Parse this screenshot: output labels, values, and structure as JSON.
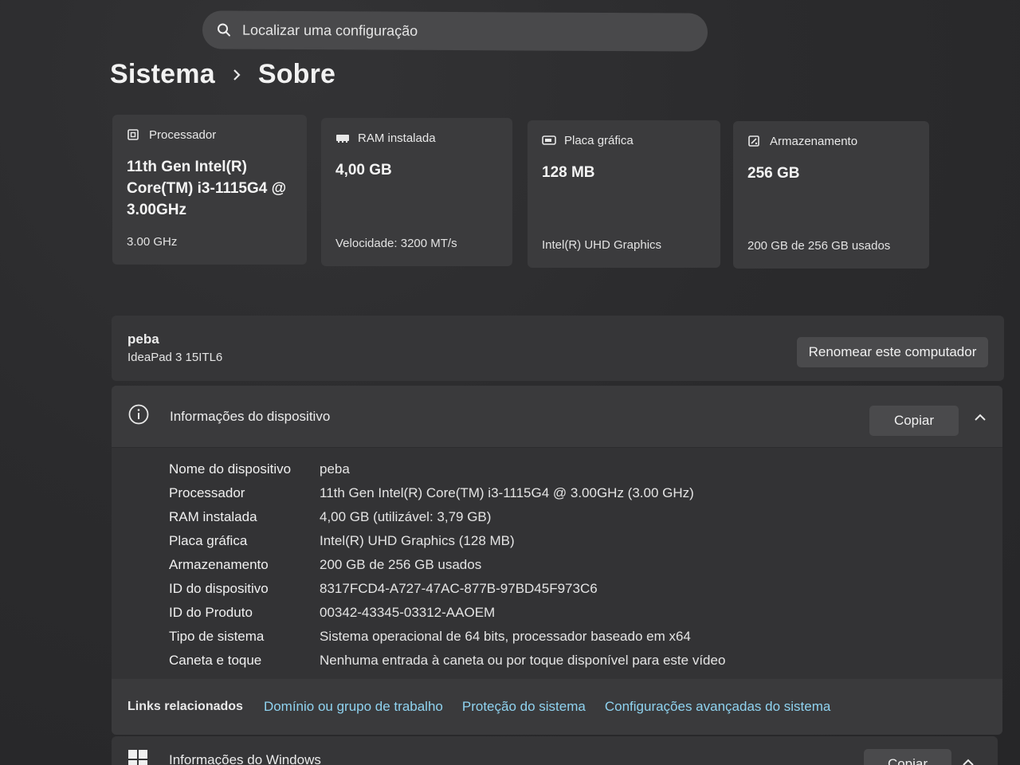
{
  "search": {
    "placeholder": "Localizar uma configuração",
    "icon": "search-icon"
  },
  "breadcrumb": {
    "parent": "Sistema",
    "current": "Sobre"
  },
  "cards": [
    {
      "title": "Processador",
      "icon": "processor-icon",
      "value": "11th Gen Intel(R) Core(TM) i3-1115G4 @ 3.00GHz",
      "detail": "3.00 GHz"
    },
    {
      "title": "RAM instalada",
      "icon": "ram-icon",
      "value": "4,00 GB",
      "detail": "Velocidade: 3200 MT/s"
    },
    {
      "title": "Placa gráfica",
      "icon": "gpu-icon",
      "value": "128 MB",
      "detail": "Intel(R) UHD Graphics"
    },
    {
      "title": "Armazenamento",
      "icon": "storage-icon",
      "value": "256 GB",
      "detail": "200 GB de 256 GB usados"
    }
  ],
  "computer": {
    "name": "peba",
    "model": "IdeaPad 3 15ITL6",
    "rename_label": "Renomear este computador"
  },
  "device_info": {
    "title": "Informações do dispositivo",
    "copy_label": "Copiar",
    "rows": [
      {
        "key": "Nome do dispositivo",
        "value": "peba"
      },
      {
        "key": "Processador",
        "value": "11th Gen Intel(R) Core(TM) i3-1115G4 @ 3.00GHz (3.00 GHz)"
      },
      {
        "key": "RAM instalada",
        "value": "4,00 GB (utilizável: 3,79 GB)"
      },
      {
        "key": "Placa gráfica",
        "value": "Intel(R) UHD Graphics (128 MB)"
      },
      {
        "key": "Armazenamento",
        "value": "200 GB de 256 GB usados"
      },
      {
        "key": "ID do dispositivo",
        "value": "8317FCD4-A727-47AC-877B-97BD45F973C6"
      },
      {
        "key": "ID do Produto",
        "value": "00342-43345-03312-AAOEM"
      },
      {
        "key": "Tipo de sistema",
        "value": "Sistema operacional de 64 bits, processador baseado em x64"
      },
      {
        "key": "Caneta e toque",
        "value": "Nenhuma entrada à caneta ou por toque disponível para este vídeo"
      }
    ]
  },
  "related_links": {
    "label": "Links relacionados",
    "links": [
      "Domínio ou grupo de trabalho",
      "Proteção do sistema",
      "Configurações avançadas do sistema"
    ]
  },
  "windows_info": {
    "title": "Informações do Windows",
    "copy_label": "Copiar"
  },
  "colors": {
    "link": "#8fd3f0",
    "card": "#3b3b3d",
    "panel": "#333335"
  }
}
